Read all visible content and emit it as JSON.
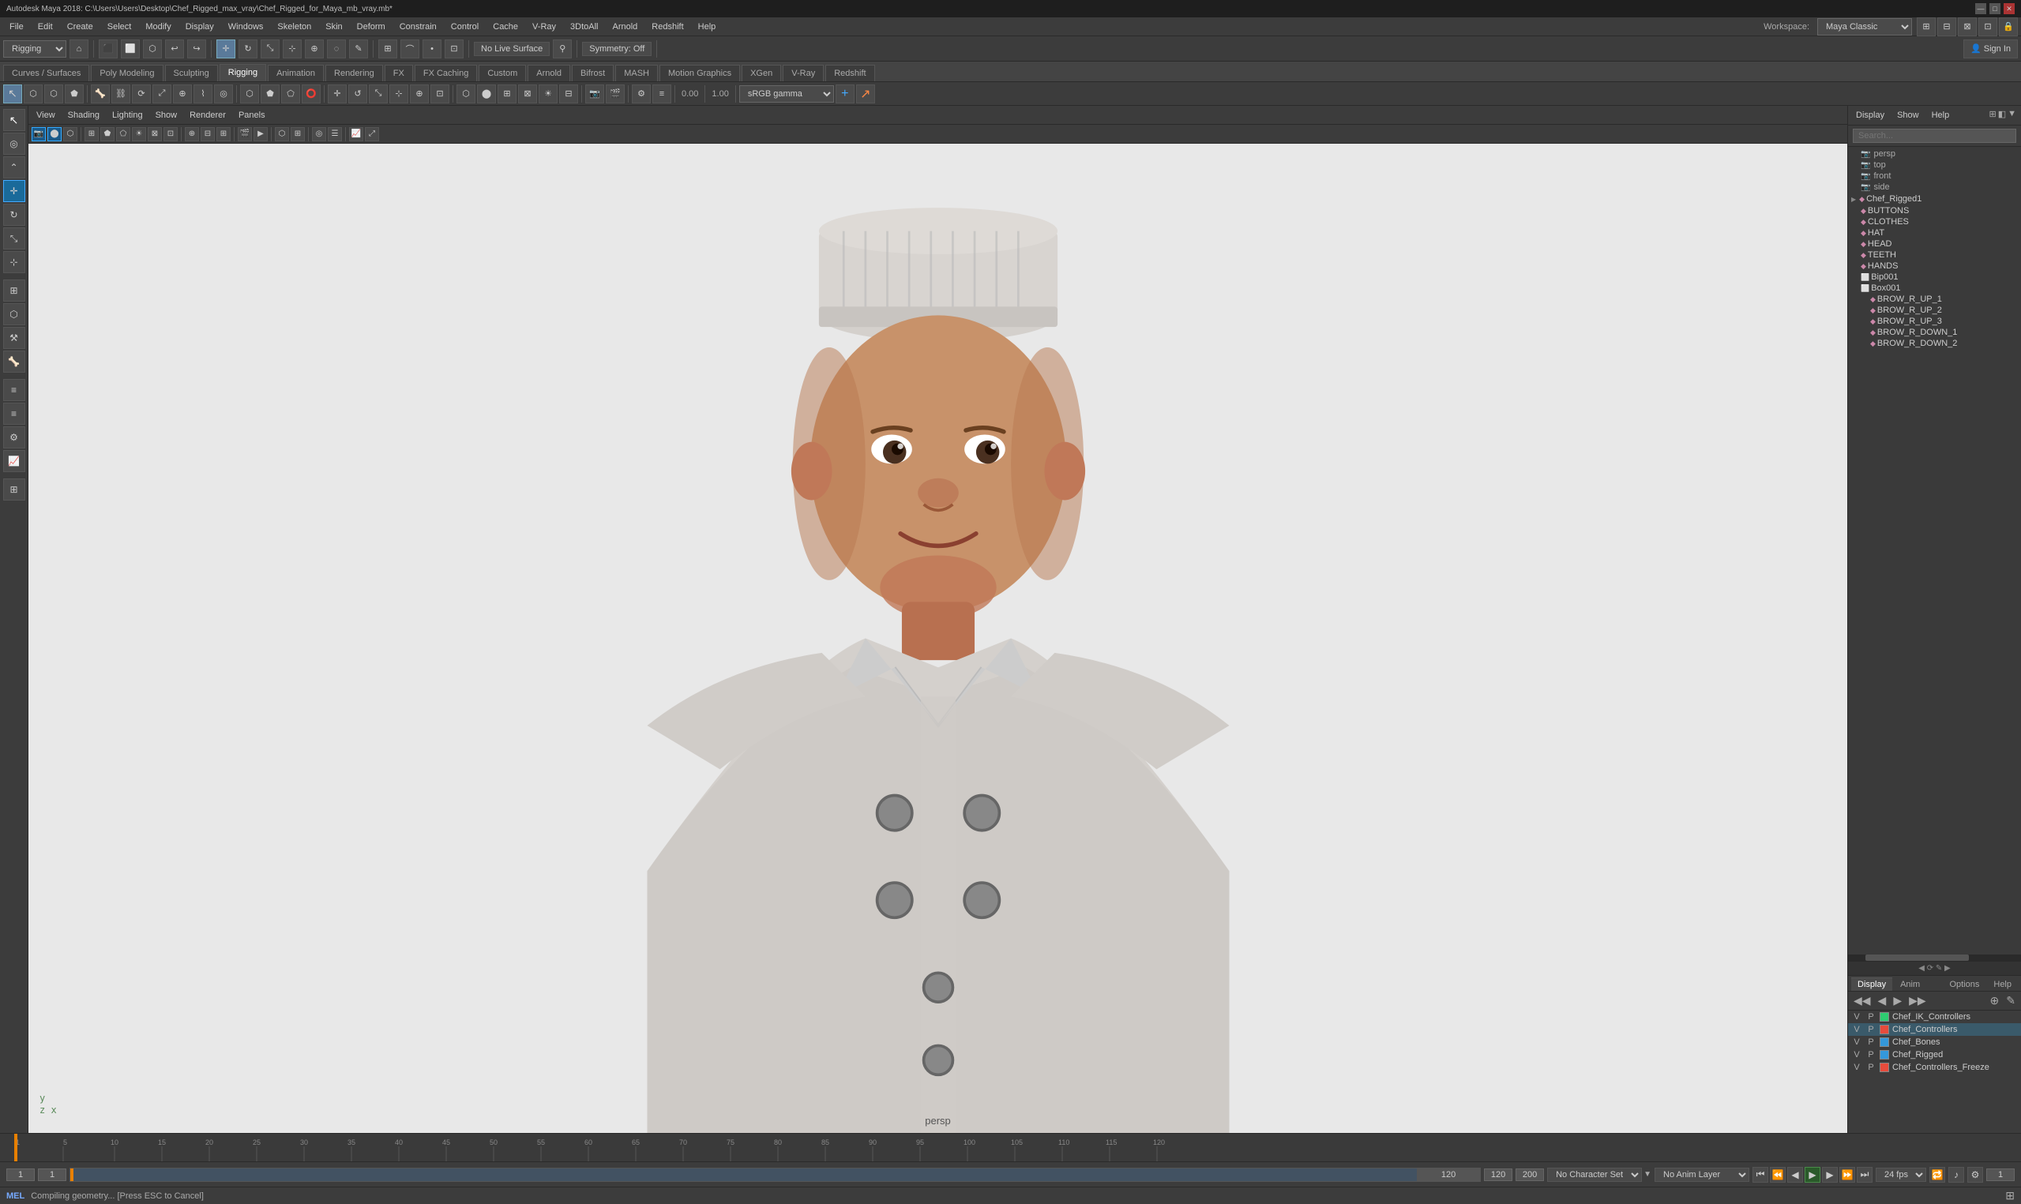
{
  "titlebar": {
    "title": "Autodesk Maya 2018: C:\\Users\\Users\\Desktop\\Chef_Rigged_max_vray\\Chef_Rigged_for_Maya_mb_vray.mb*",
    "min": "—",
    "max": "□",
    "close": "✕"
  },
  "menubar": {
    "items": [
      "File",
      "Edit",
      "Create",
      "Select",
      "Modify",
      "Display",
      "Windows",
      "Skeleton",
      "Skin",
      "Deform",
      "Constrain",
      "Control",
      "Cache",
      "V-Ray",
      "3DtoAll",
      "Arnold",
      "Redshift",
      "Help"
    ]
  },
  "toolbar": {
    "module": "Rigging",
    "no_live_surface": "No Live Surface",
    "symmetry": "Symmetry: Off",
    "workspace_label": "Workspace:",
    "workspace_value": "Maya Classic"
  },
  "tabs": {
    "items": [
      "Curves / Surfaces",
      "Poly Modeling",
      "Sculpting",
      "Rigging",
      "Animation",
      "Rendering",
      "FX",
      "FX Caching",
      "Custom",
      "Arnold",
      "Bifrost",
      "MASH",
      "Motion Graphics",
      "XGen",
      "V-Ray",
      "Redshift"
    ]
  },
  "viewport": {
    "menus": [
      "View",
      "Shading",
      "Lighting",
      "Show",
      "Renderer",
      "Panels"
    ],
    "label_persp": "persp",
    "axis": {
      "y": "y",
      "z_x": "z  x"
    },
    "offset_value": "0.00",
    "scale_value": "1.00",
    "gamma": "sRGB gamma"
  },
  "outliner": {
    "cameras": [
      {
        "name": "persp"
      },
      {
        "name": "top"
      },
      {
        "name": "front"
      },
      {
        "name": "side"
      }
    ],
    "nodes": [
      {
        "name": "Chef_Rigged1",
        "level": 0,
        "expanded": true
      },
      {
        "name": "BUTTONS",
        "level": 1
      },
      {
        "name": "CLOTHES",
        "level": 1
      },
      {
        "name": "HAT",
        "level": 1
      },
      {
        "name": "HEAD",
        "level": 1
      },
      {
        "name": "TEETH",
        "level": 1
      },
      {
        "name": "HANDS",
        "level": 1
      },
      {
        "name": "Bip001",
        "level": 1
      },
      {
        "name": "Box001",
        "level": 1
      },
      {
        "name": "BROW_R_UP_1",
        "level": 2
      },
      {
        "name": "BROW_R_UP_2",
        "level": 2
      },
      {
        "name": "BROW_R_UP_3",
        "level": 2
      },
      {
        "name": "BROW_R_DOWN_1",
        "level": 2
      },
      {
        "name": "BROW_R_DOWN_2",
        "level": 2
      }
    ],
    "panel_buttons": [
      "Display",
      "Show",
      "Help"
    ],
    "search_placeholder": "Search..."
  },
  "layers": {
    "tabs": [
      "Display",
      "Anim"
    ],
    "options_label": "Options",
    "help_label": "Help",
    "rows": [
      {
        "v": "V",
        "p": "P",
        "color": "#2ecc71",
        "name": "Chef_IK_Controllers"
      },
      {
        "v": "V",
        "p": "P",
        "color": "#e74c3c",
        "name": "Chef_Controllers",
        "selected": true
      },
      {
        "v": "V",
        "p": "P",
        "color": "#3498db",
        "name": "Chef_Bones"
      },
      {
        "v": "V",
        "p": "P",
        "color": "#3498db",
        "name": "Chef_Rigged"
      },
      {
        "v": "V",
        "p": "P",
        "color": "#e74c3c",
        "name": "Chef_Controllers_Freeze"
      }
    ]
  },
  "timeline": {
    "start": 1,
    "end": 120,
    "current_frame": 1,
    "ticks": [
      1,
      5,
      10,
      15,
      20,
      25,
      30,
      35,
      40,
      45,
      50,
      55,
      60,
      65,
      70,
      75,
      80,
      85,
      90,
      95,
      100,
      105,
      110,
      115,
      120
    ]
  },
  "time_controls": {
    "current_frame": "1",
    "range_start": "1",
    "range_end": "120",
    "range_end2": "120",
    "range_max": "200",
    "no_character_set": "No Character Set",
    "no_anim_layer": "No Anim Layer",
    "fps": "24 fps"
  },
  "status_bar": {
    "mel_label": "MEL",
    "command_text": "Compiling geometry... [Press ESC to Cancel]"
  }
}
